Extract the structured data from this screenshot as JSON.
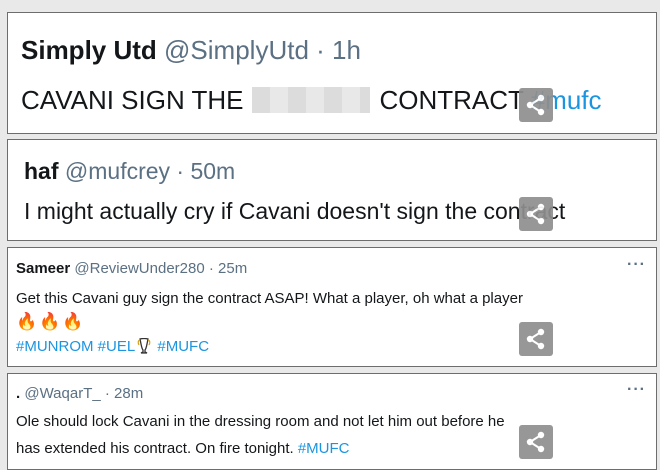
{
  "tweets": [
    {
      "name": "Simply Utd",
      "handle": "@SimplyUtd",
      "time": "· 1h",
      "text_before": "CAVANI SIGN THE",
      "text_after": "CONTRACT",
      "hashtags": "#mufc"
    },
    {
      "name": "haf",
      "handle": "@mufcrey",
      "time": "· 50m",
      "text": "I might actually cry if Cavani doesn't sign the contract"
    },
    {
      "name": "Sameer",
      "handle": "@ReviewUnder280",
      "time": "· 25m",
      "text": "Get this Cavani guy sign the contract ASAP! What a player, oh what a player",
      "emojis": "🔥🔥🔥",
      "tag1": "#MUNROM",
      "tag2": "#UEL",
      "tag3": "#MUFC",
      "more": "···"
    },
    {
      "name": ".",
      "handle": "@WaqarT_",
      "time": "· 28m",
      "text1": "Ole should lock Cavani in the dressing room and not let him out before he",
      "text2": "has extended his contract. On fire tonight.",
      "tag": "#MUFC",
      "more": "···"
    }
  ],
  "icons": {
    "share": "share-icon",
    "trophy": "europa-league-trophy-icon"
  },
  "colors": {
    "link": "#1b95e0",
    "meta": "#5b7083",
    "text": "#14171a",
    "share_bg": "#8f8f8f"
  }
}
